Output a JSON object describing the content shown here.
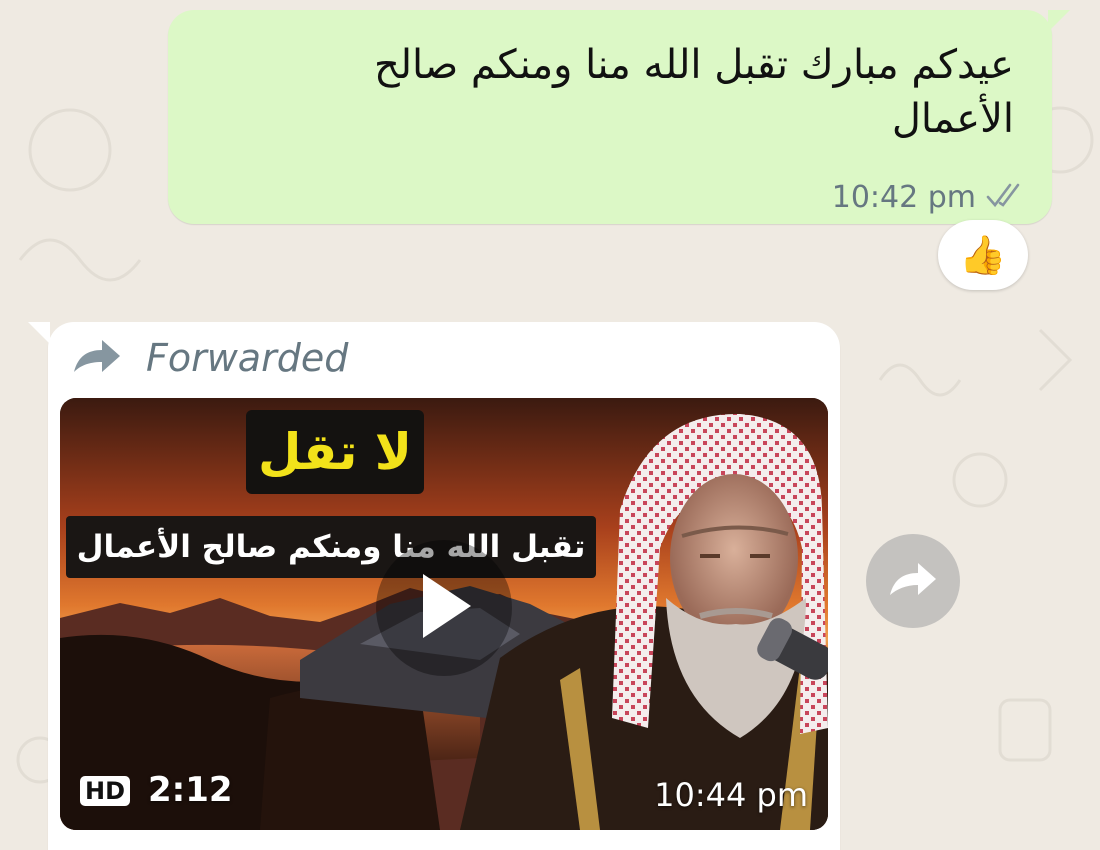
{
  "messages": {
    "outgoing": {
      "text_line1": "عيدكم مبارك تقبل الله منا ومنكم صالح",
      "text_line2": "الأعمال",
      "time": "10:42 pm",
      "status_icon": "double-check-icon",
      "reaction": "👍"
    },
    "incoming": {
      "forwarded_label": "Forwarded",
      "forward_icon": "forward-arrow-icon",
      "video": {
        "title": "لا تقل",
        "subtitle": "تقبل الله منا ومنكم صالح الأعمال",
        "hd_label": "HD",
        "duration": "2:12",
        "time": "10:44 pm"
      }
    }
  },
  "share_icon": "share-arrow-icon",
  "colors": {
    "chat_bg": "#efeae2",
    "outgoing_bubble": "#dcf8c6",
    "incoming_bubble": "#ffffff",
    "meta_text": "#667781",
    "title_yellow": "#f2e21a"
  }
}
